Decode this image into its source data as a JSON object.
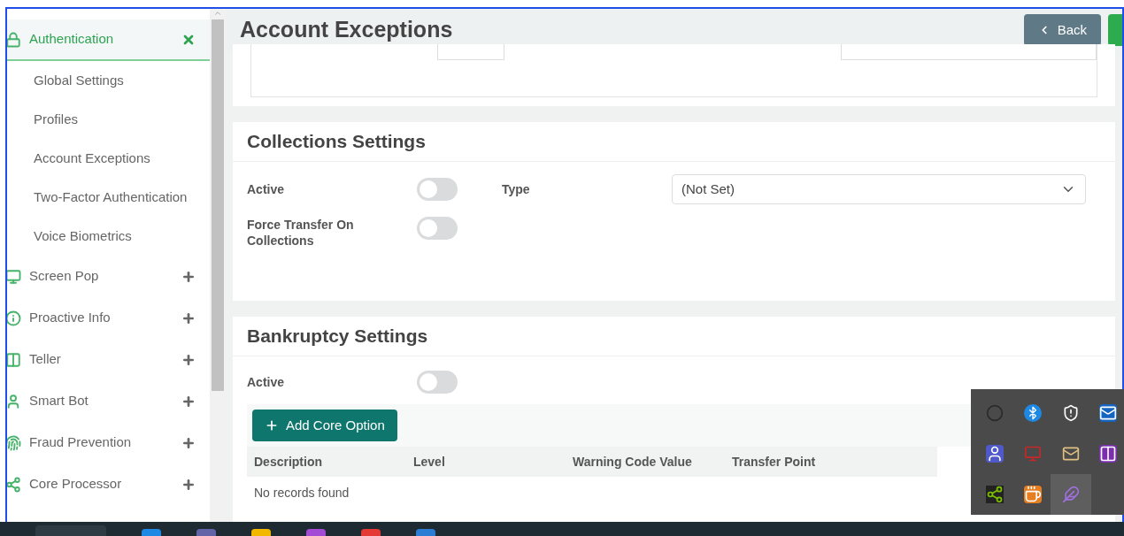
{
  "sidebar": {
    "items": [
      {
        "label": "Authentication",
        "expanded": true,
        "children": [
          {
            "label": "Global Settings"
          },
          {
            "label": "Profiles"
          },
          {
            "label": "Account Exceptions"
          },
          {
            "label": "Two-Factor Authentication"
          },
          {
            "label": "Voice Biometrics"
          }
        ]
      },
      {
        "label": "Screen Pop",
        "expanded": false
      },
      {
        "label": "Proactive Info",
        "expanded": false
      },
      {
        "label": "Teller",
        "expanded": false
      },
      {
        "label": "Smart Bot",
        "expanded": false
      },
      {
        "label": "Fraud Prevention",
        "expanded": false
      },
      {
        "label": "Core Processor",
        "expanded": false
      }
    ]
  },
  "header": {
    "title": "Account Exceptions",
    "back_button": "Back"
  },
  "collections": {
    "title": "Collections Settings",
    "active_label": "Active",
    "active_on": false,
    "type_label": "Type",
    "type_value": "(Not Set)",
    "force_label": "Force Transfer On Collections",
    "force_on": false
  },
  "bankruptcy": {
    "title": "Bankruptcy Settings",
    "active_label": "Active",
    "active_on": false,
    "add_button": "Add Core Option",
    "columns": [
      "Description",
      "Level",
      "Warning Code Value",
      "Transfer Point"
    ],
    "empty_message": "No records found"
  }
}
